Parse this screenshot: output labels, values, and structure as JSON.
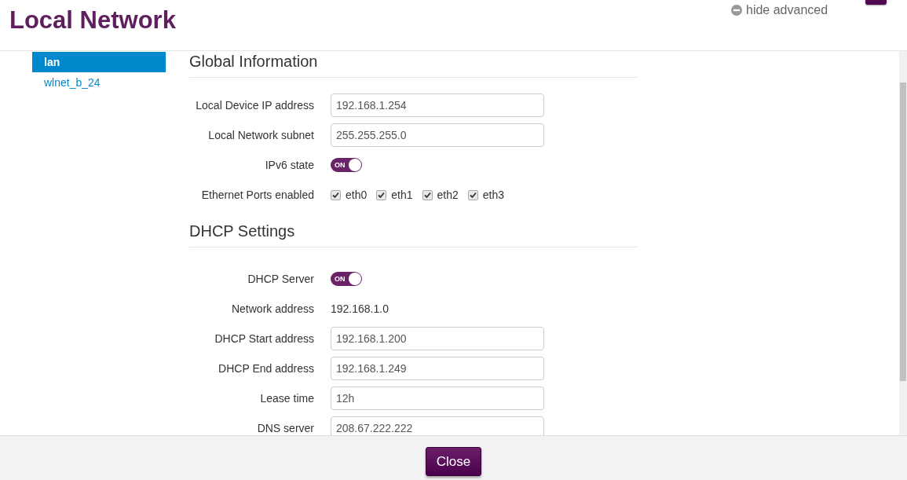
{
  "header": {
    "title": "Local Network",
    "hide_advanced": "hide advanced"
  },
  "sidebar": {
    "items": [
      {
        "label": "lan",
        "selected": true
      },
      {
        "label": "wlnet_b_24",
        "selected": false
      }
    ]
  },
  "sections": [
    {
      "title": "Global Information",
      "rows": [
        {
          "kind": "input",
          "label": "Local Device IP address",
          "value": "192.168.1.254"
        },
        {
          "kind": "input",
          "label": "Local Network subnet",
          "value": "255.255.255.0"
        },
        {
          "kind": "toggle",
          "label": "IPv6 state",
          "on": true,
          "text": "ON"
        },
        {
          "kind": "checks",
          "label": "Ethernet Ports enabled",
          "options": [
            {
              "label": "eth0",
              "checked": true
            },
            {
              "label": "eth1",
              "checked": true
            },
            {
              "label": "eth2",
              "checked": true
            },
            {
              "label": "eth3",
              "checked": true
            }
          ]
        }
      ]
    },
    {
      "title": "DHCP Settings",
      "rows": [
        {
          "kind": "toggle",
          "label": "DHCP Server",
          "on": true,
          "text": "ON"
        },
        {
          "kind": "text",
          "label": "Network address",
          "value": "192.168.1.0"
        },
        {
          "kind": "input",
          "label": "DHCP Start address",
          "value": "192.168.1.200"
        },
        {
          "kind": "input",
          "label": "DHCP End address",
          "value": "192.168.1.249"
        },
        {
          "kind": "input",
          "label": "Lease time",
          "value": "12h"
        },
        {
          "kind": "input",
          "label": "DNS server",
          "value": "208.67.222.222"
        }
      ]
    }
  ],
  "footer": {
    "close": "Close"
  }
}
